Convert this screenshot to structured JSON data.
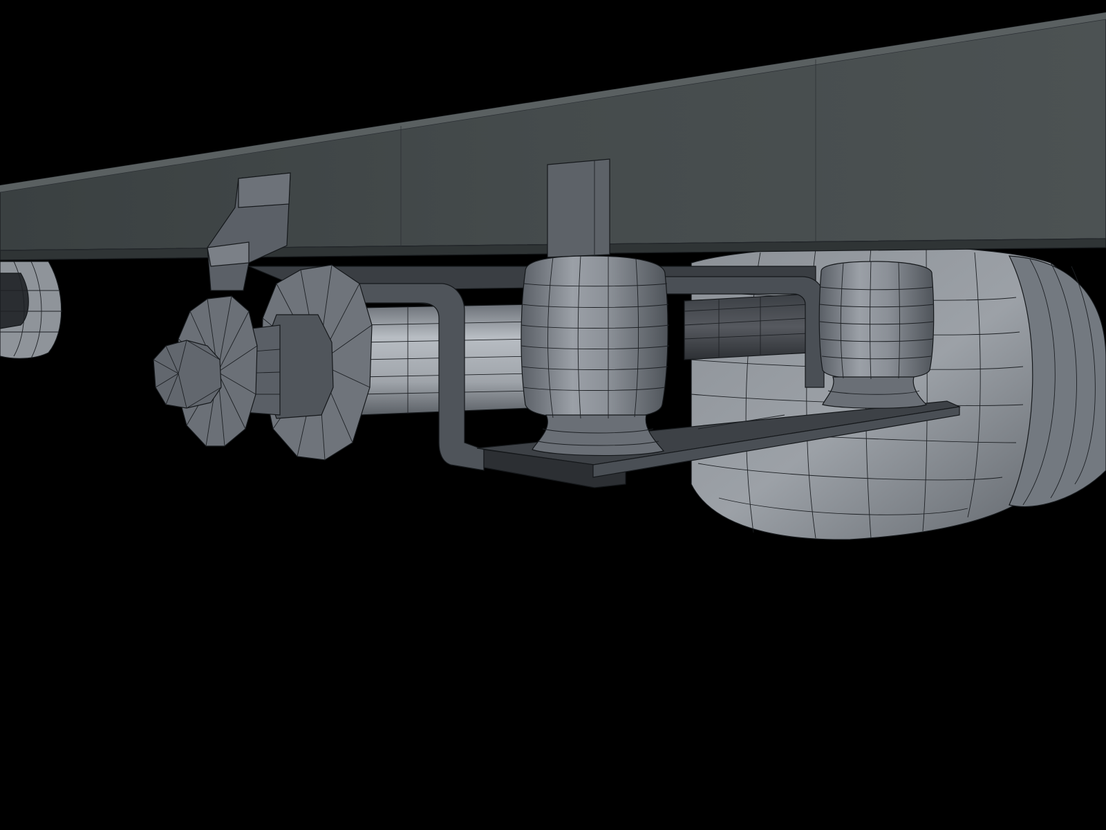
{
  "scene": {
    "background_color": "#000000",
    "frame_color": "#43494a",
    "metal_light": "#aeb3b9",
    "metal_mid": "#7f858c",
    "metal_dark": "#4e5359",
    "wireframe_color": "#1d2024"
  }
}
